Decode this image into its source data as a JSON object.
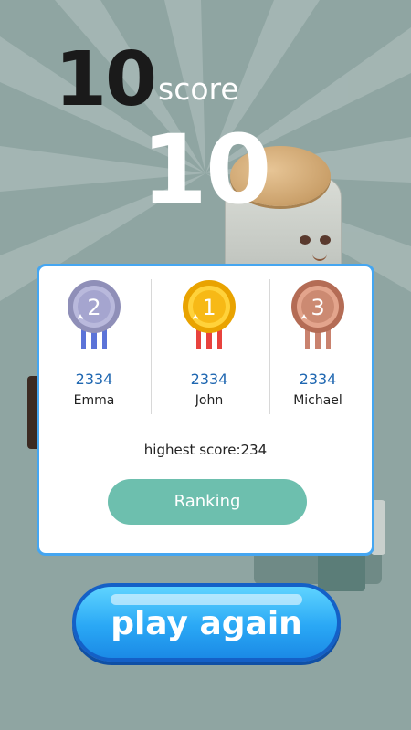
{
  "hud": {
    "level": "10",
    "score_label": "score",
    "score_value": "10"
  },
  "leaderboard": {
    "entries": [
      {
        "rank": "2",
        "score": "2334",
        "name": "Emma",
        "medal": "silver"
      },
      {
        "rank": "1",
        "score": "2334",
        "name": "John",
        "medal": "gold"
      },
      {
        "rank": "3",
        "score": "2334",
        "name": "Michael",
        "medal": "bronze"
      }
    ],
    "highest_score": "highest score:234",
    "ranking_label": "Ranking"
  },
  "play_again_label": "play again",
  "colors": {
    "background": "#8fa5a2",
    "card_border": "#45a6f1",
    "ranking_button": "#6dbfae",
    "play_button": "#2aa8f5",
    "score_text": "#1f67b1"
  }
}
